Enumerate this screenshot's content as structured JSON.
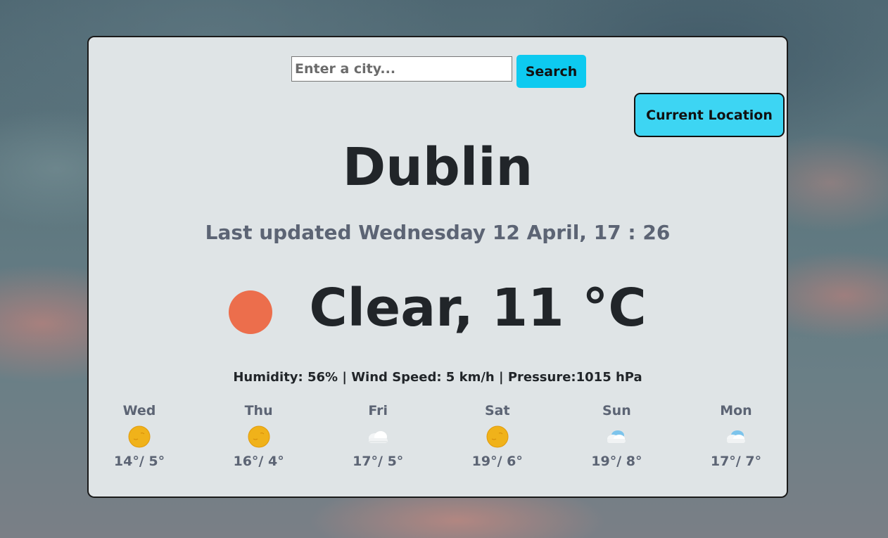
{
  "search": {
    "placeholder": "Enter a city...",
    "button_label": "Search"
  },
  "location_button_label": "Current Location",
  "weather": {
    "city": "Dublin",
    "last_updated": "Last updated Wednesday 12 April, 17 : 26",
    "condition": "Clear, 11 °C",
    "icon": "sun-icon",
    "details": "Humidity: 56% | Wind Speed: 5 km/h | Pressure:1015 hPa"
  },
  "forecast": [
    {
      "day": "Wed",
      "icon": "sun-icon",
      "temps": "14°/ 5°"
    },
    {
      "day": "Thu",
      "icon": "sun-icon",
      "temps": "16°/ 4°"
    },
    {
      "day": "Fri",
      "icon": "cloud-icon",
      "temps": "17°/ 5°"
    },
    {
      "day": "Sat",
      "icon": "sun-icon",
      "temps": "19°/ 6°"
    },
    {
      "day": "Sun",
      "icon": "rain-cloud-icon",
      "temps": "19°/ 8°"
    },
    {
      "day": "Mon",
      "icon": "rain-cloud-icon",
      "temps": "17°/ 7°"
    }
  ],
  "colors": {
    "accent": "#0dcaf0",
    "location_button": "#3dd5f3",
    "sun_dot": "#ec6e4c",
    "card_background": "#dfe4e6"
  }
}
